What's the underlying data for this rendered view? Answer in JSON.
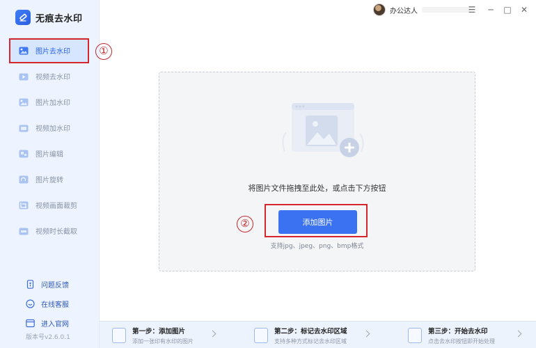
{
  "app": {
    "name": "无痕去水印",
    "version": "版本号v2.6.0.1"
  },
  "sidebar": {
    "items": [
      {
        "label": "图片去水印",
        "icon": "image-watermark-remove-icon",
        "active": true
      },
      {
        "label": "视频去水印",
        "icon": "video-watermark-remove-icon",
        "active": false
      },
      {
        "label": "图片加水印",
        "icon": "image-watermark-add-icon",
        "active": false
      },
      {
        "label": "视频加水印",
        "icon": "video-watermark-add-icon",
        "active": false
      },
      {
        "label": "图片编辑",
        "icon": "image-edit-icon",
        "active": false
      },
      {
        "label": "图片旋转",
        "icon": "image-rotate-icon",
        "active": false
      },
      {
        "label": "视频画面裁剪",
        "icon": "video-crop-icon",
        "active": false
      },
      {
        "label": "视频时长截取",
        "icon": "video-trim-icon",
        "active": false
      }
    ],
    "footer": [
      {
        "label": "问题反馈",
        "icon": "feedback-icon"
      },
      {
        "label": "在线客服",
        "icon": "support-icon"
      },
      {
        "label": "进入官网",
        "icon": "website-icon"
      }
    ]
  },
  "titlebar": {
    "user_name": "办公达人",
    "menu_icon": "menu-icon",
    "minimize_icon": "minimize-icon",
    "maximize_icon": "maximize-icon",
    "close_icon": "close-icon"
  },
  "main": {
    "drop_text": "将图片文件拖拽至此处，或点击下方按钮",
    "add_button_label": "添加图片",
    "formats_text": "支持jpg、jpeg、png、bmp格式"
  },
  "annotations": {
    "marker_1": "①",
    "marker_2": "②",
    "highlight_color": "#d7262b"
  },
  "steps": [
    {
      "title": "第一步：添加图片",
      "desc": "添加一张印有水印的图片"
    },
    {
      "title": "第二步：标记去水印区域",
      "desc": "支持多种方式标记去水印区域"
    },
    {
      "title": "第三步：开始去水印",
      "desc": "点击去水印按钮即开始处理"
    }
  ],
  "colors": {
    "accent": "#3a72f2",
    "sidebar_bg": "#eef4ff",
    "active_bg": "#d7e6ff"
  }
}
